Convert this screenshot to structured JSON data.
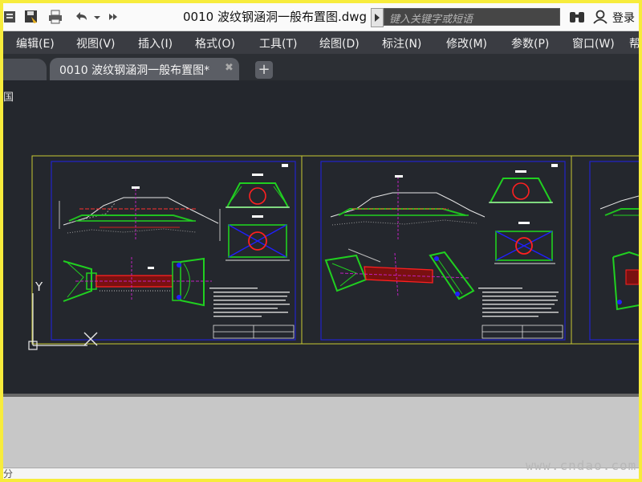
{
  "title_bar": {
    "document_title": "0010 波纹钢涵洞一般布置图.dwg",
    "search_placeholder": "键入关键字或短语",
    "login_label": "登录"
  },
  "menu": {
    "items": [
      "编辑(E)",
      "视图(V)",
      "插入(I)",
      "格式(O)",
      "工具(T)",
      "绘图(D)",
      "标注(N)",
      "修改(M)",
      "参数(P)",
      "窗口(W)",
      "帮"
    ]
  },
  "tabs": {
    "active_label": "0010 波纹钢涵洞一般布置图*",
    "close_glyph": "✖",
    "add_glyph": "+"
  },
  "canvas": {
    "viewport_label": "国",
    "ucs_x": "X",
    "ucs_y": "Y",
    "background": "#24272d",
    "sheet_border_color": "#c8c832",
    "frame_color": "#2020c0"
  },
  "status": {
    "left_text": "分"
  },
  "watermark": "www.cndao.com",
  "icons": [
    "sheet-set-icon",
    "save-as-icon",
    "plot-icon",
    "undo-icon",
    "dropdown-icon",
    "more-icon",
    "binoculars-icon",
    "user-icon"
  ]
}
